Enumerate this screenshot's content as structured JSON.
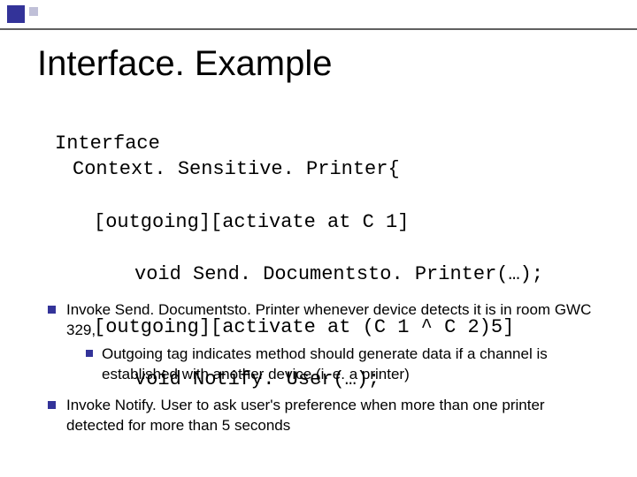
{
  "title": "Interface. Example",
  "code": {
    "l1": "Interface",
    "l2": "Context. Sensitive. Printer{",
    "l3": "[outgoing][activate at C 1]",
    "l4": "void Send. Documentsto. Printer(…);",
    "l5": "[outgoing][activate at (C 1 ^ C 2)5]",
    "l6": "void Notify. User(…);"
  },
  "bullets": {
    "b1": "Invoke Send. Documentsto. Printer whenever device detects it is in room GWC 329,",
    "b1sub": "Outgoing tag indicates method should generate data if a channel is established with another device (i. e. a printer)",
    "b2": "Invoke Notify. User to ask user's preference when more than one printer detected for more than 5 seconds"
  }
}
